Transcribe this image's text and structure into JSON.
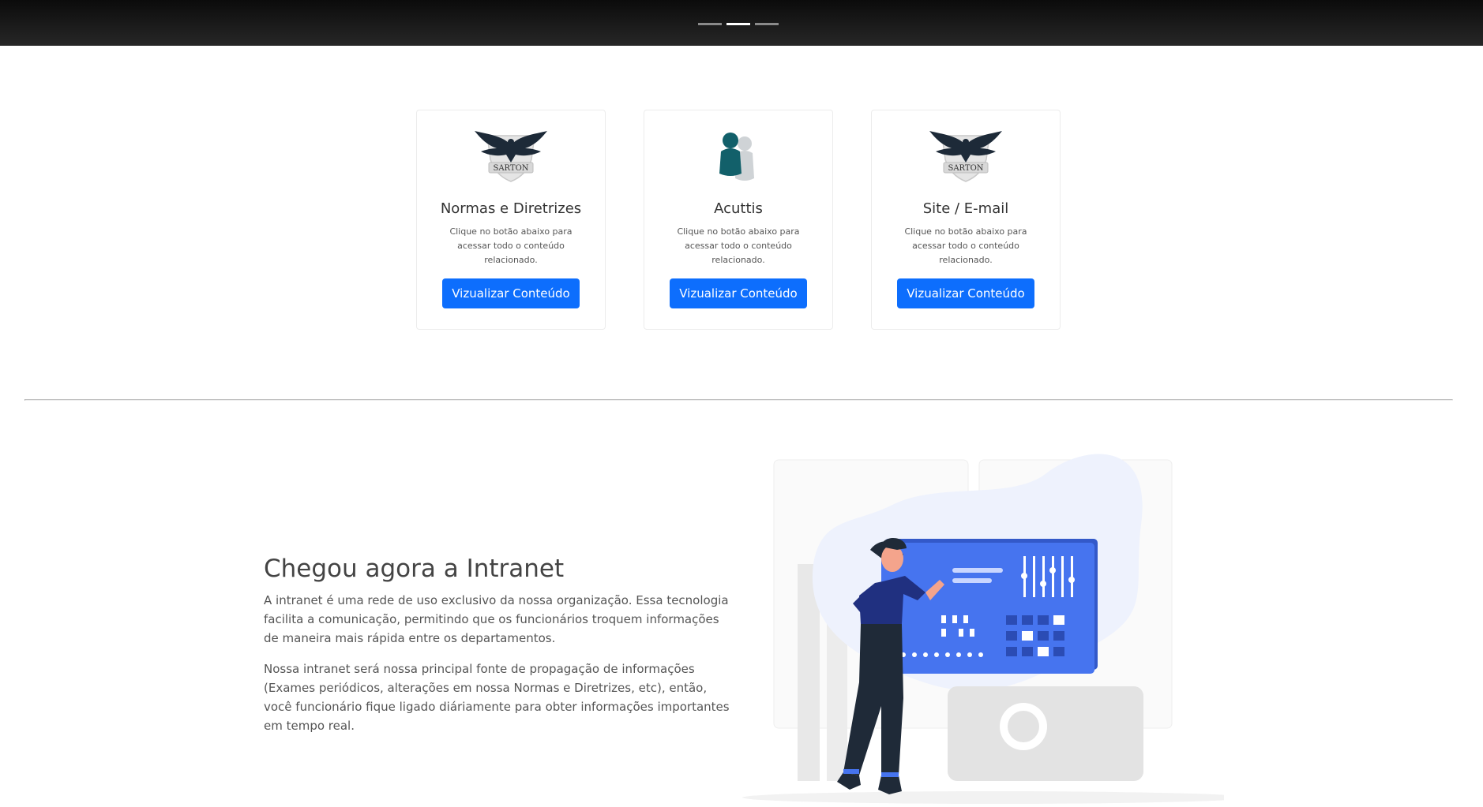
{
  "hero": {
    "slides": [
      "slide-1",
      "slide-2",
      "slide-3"
    ],
    "active_slide_index": 1
  },
  "cards": [
    {
      "logo": "sarton-eagle-logo",
      "logo_text": "SARTON",
      "title": "Normas e Diretrizes",
      "text": "Clique no botão abaixo para acessar todo o conteúdo relacionado.",
      "button": "Vizualizar Conteúdo"
    },
    {
      "logo": "acuttis-people-icon",
      "title": "Acuttis",
      "text": "Clique no botão abaixo para acessar todo o conteúdo relacionado.",
      "button": "Vizualizar Conteúdo"
    },
    {
      "logo": "sarton-eagle-logo",
      "logo_text": "SARTON",
      "title": "Site / E-mail",
      "text": "Clique no botão abaixo para acessar todo o conteúdo relacionado.",
      "button": "Vizualizar Conteúdo"
    }
  ],
  "intro": {
    "title": "Chegou agora a Intranet",
    "paragraphs": [
      "A intranet é uma rede de uso exclusivo da nossa organização. Essa tecnologia facilita a comunicação, permitindo que os funcionários troquem informações de maneira mais rápida entre os departamentos.",
      "Nossa intranet será nossa principal fonte de propagação de informações (Exames periódicos, alterações em nossa Normas e Diretrizes, etc), então, você funcionário fique ligado diáriamente para obter informações importantes em tempo real."
    ]
  },
  "illustration": {
    "name": "person-at-dashboard-illustration"
  },
  "colors": {
    "primary": "#0d6efd",
    "accent_blue": "#3f6ee8",
    "teal": "#12606a",
    "blob": "#eef2fd"
  }
}
